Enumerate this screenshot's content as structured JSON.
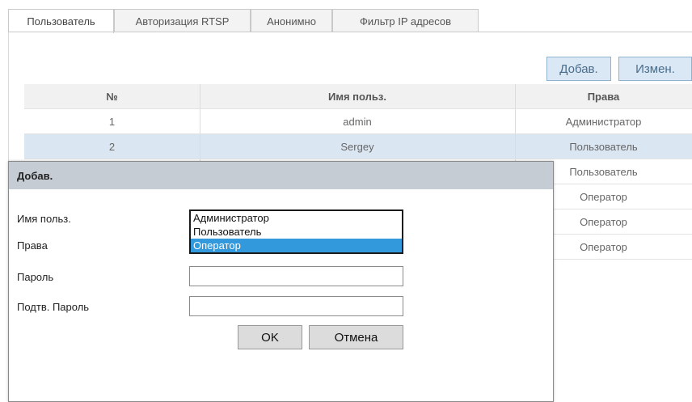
{
  "tabs": [
    {
      "label": "Пользователь"
    },
    {
      "label": "Авторизация RTSP"
    },
    {
      "label": "Анонимно"
    },
    {
      "label": "Фильтр IP адресов"
    }
  ],
  "toolbar": {
    "add_label": "Добав.",
    "edit_label": "Измен."
  },
  "table": {
    "headers": [
      "№",
      "Имя польз.",
      "Права"
    ],
    "rows": [
      [
        "1",
        "admin",
        "Администратор"
      ],
      [
        "2",
        "Sergey",
        "Пользователь"
      ],
      [
        "",
        "",
        "Пользователь"
      ],
      [
        "",
        "",
        "Оператор"
      ],
      [
        "",
        "",
        "Оператор"
      ],
      [
        "",
        "",
        "Оператор"
      ]
    ]
  },
  "dialog": {
    "title": "Добав.",
    "username_label": "Имя польз.",
    "rights_label": "Права",
    "password_label": "Пароль",
    "confirm_label": "Подтв. Пароль",
    "rights_options": [
      "Администратор",
      "Пользователь",
      "Оператор"
    ],
    "selected_option": "Оператор",
    "ok_label": "OK",
    "cancel_label": "Отмена"
  },
  "colors": {
    "selected_row": "#dbe6f3",
    "dialog_header": "#c6ccd3",
    "option_highlight": "#3399dd"
  }
}
